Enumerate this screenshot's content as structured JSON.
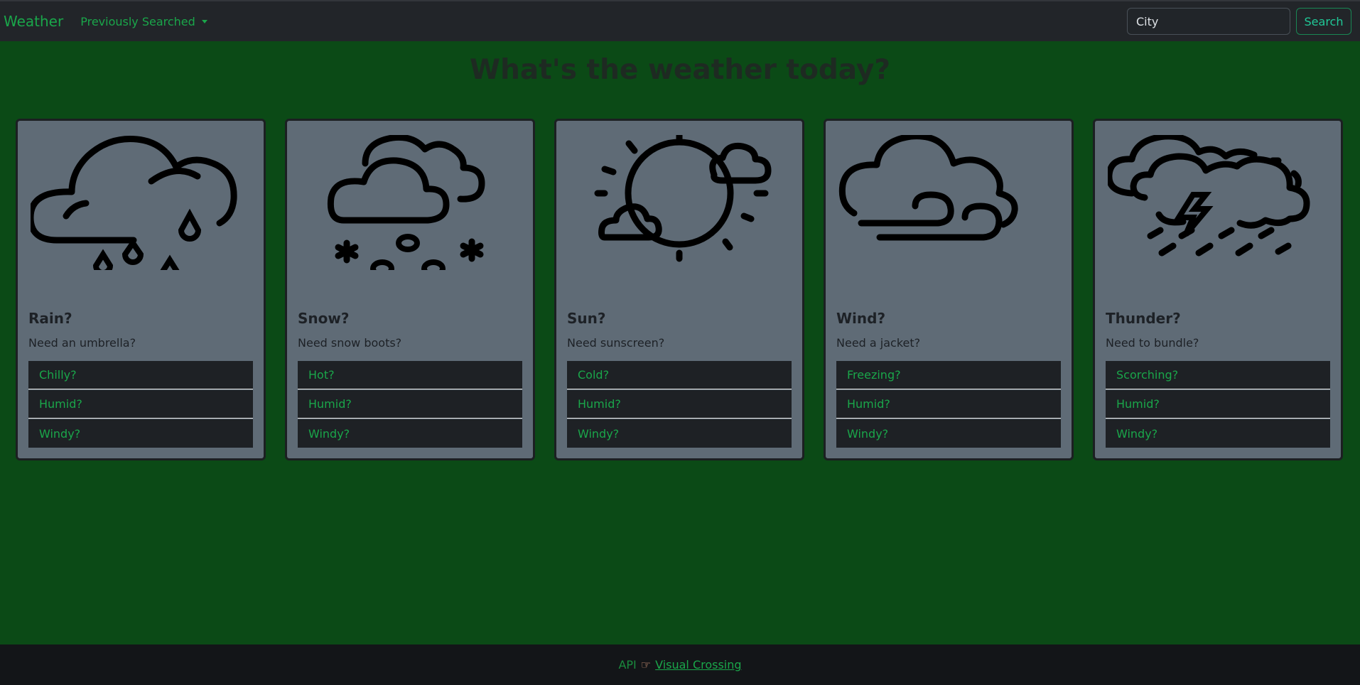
{
  "navbar": {
    "brand": "Weather",
    "dropdown_label": "Previously Searched",
    "search_placeholder": "City",
    "search_button": "Search"
  },
  "main": {
    "title": "What's the weather today?",
    "cards": [
      {
        "icon": "rain-cloud-icon",
        "title": "Rain?",
        "text": "Need an umbrella?",
        "options": [
          "Chilly?",
          "Humid?",
          "Windy?"
        ]
      },
      {
        "icon": "snow-cloud-icon",
        "title": "Snow?",
        "text": "Need snow boots?",
        "options": [
          "Hot?",
          "Humid?",
          "Windy?"
        ]
      },
      {
        "icon": "sun-cloud-icon",
        "title": "Sun?",
        "text": "Need sunscreen?",
        "options": [
          "Cold?",
          "Humid?",
          "Windy?"
        ]
      },
      {
        "icon": "wind-cloud-icon",
        "title": "Wind?",
        "text": "Need a jacket?",
        "options": [
          "Freezing?",
          "Humid?",
          "Windy?"
        ]
      },
      {
        "icon": "thunder-cloud-icon",
        "title": "Thunder?",
        "text": "Need to bundle?",
        "options": [
          "Scorching?",
          "Humid?",
          "Windy?"
        ]
      }
    ]
  },
  "footer": {
    "api_label": "API",
    "hand_icon": "pointing-hand-icon",
    "link_text": "Visual Crossing"
  },
  "colors": {
    "background": "#0b4a16",
    "navbar": "#222529",
    "card": "#5f6b76",
    "accent": "#1aa64a"
  }
}
